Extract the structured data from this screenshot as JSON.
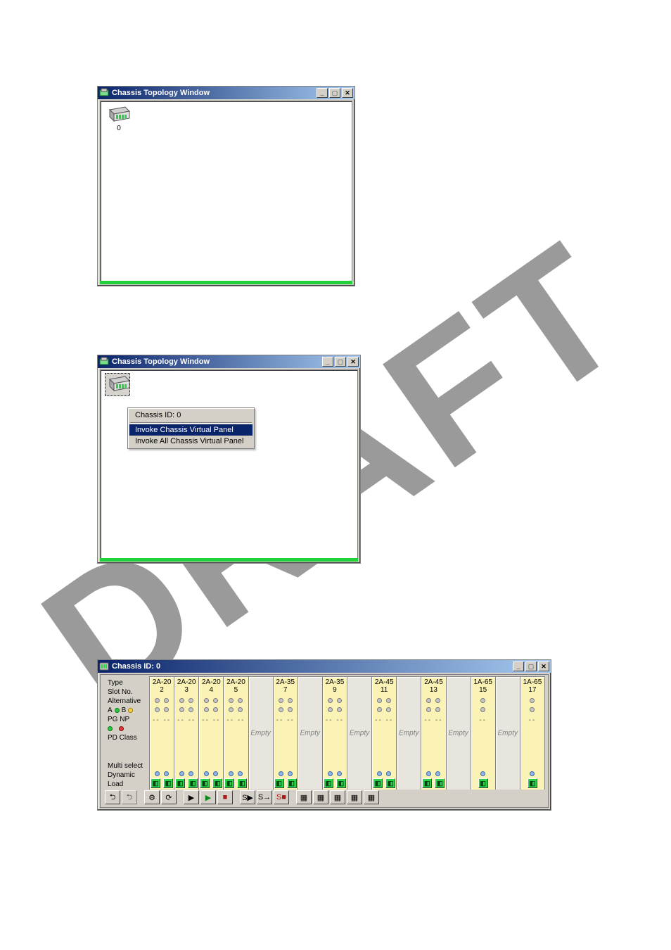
{
  "watermark_text": "DRAFT",
  "topology_window": {
    "title": "Chassis Topology Window",
    "chassis_label": "0"
  },
  "topology_window_menu": {
    "title": "Chassis Topology Window",
    "menu": {
      "header": "Chassis ID:   0",
      "items": [
        "Invoke Chassis Virtual Panel",
        "Invoke All Chassis Virtual Panel"
      ],
      "selected_index": 0
    }
  },
  "chassis_panel": {
    "title": "Chassis ID: 0",
    "row_labels": {
      "type": "Type",
      "slot_no": "Slot No.",
      "alternative": "Alternative",
      "ab": "A ● B ●",
      "pg_np": "PG NP",
      "pd_class": "PD Class",
      "multiselect": "Multi select",
      "dynamic_load": "Dynamic Load"
    },
    "slots": [
      {
        "type": "2A-20",
        "num": "2",
        "filled": true,
        "pairs": 2,
        "pd": "-- --"
      },
      {
        "type": "2A-20",
        "num": "3",
        "filled": true,
        "pairs": 2,
        "pd": "-- --"
      },
      {
        "type": "2A-20",
        "num": "4",
        "filled": true,
        "pairs": 2,
        "pd": "-- --"
      },
      {
        "type": "2A-20",
        "num": "5",
        "filled": true,
        "pairs": 2,
        "pd": "-- --"
      },
      {
        "empty_label": "Empty",
        "filled": false
      },
      {
        "type": "2A-35",
        "num": "7",
        "filled": true,
        "pairs": 2,
        "pd": "-- --"
      },
      {
        "empty_label": "Empty",
        "filled": false
      },
      {
        "type": "2A-35",
        "num": "9",
        "filled": true,
        "pairs": 2,
        "pd": "-- --"
      },
      {
        "empty_label": "Empty",
        "filled": false
      },
      {
        "type": "2A-45",
        "num": "11",
        "filled": true,
        "pairs": 2,
        "pd": "-- --"
      },
      {
        "empty_label": "Empty",
        "filled": false
      },
      {
        "type": "2A-45",
        "num": "13",
        "filled": true,
        "pairs": 2,
        "pd": "-- --"
      },
      {
        "empty_label": "Empty",
        "filled": false
      },
      {
        "type": "1A-65",
        "num": "15",
        "filled": true,
        "pairs": 1,
        "pd": "--"
      },
      {
        "empty_label": "Empty",
        "filled": false
      },
      {
        "type": "1A-65",
        "num": "17",
        "filled": true,
        "pairs": 1,
        "pd": "--"
      }
    ],
    "toolbar_icons": [
      "nav-back-icon",
      "nav-back2-icon",
      "",
      "scan-icon",
      "refresh-icon",
      "",
      "play-icon",
      "play-green-icon",
      "stop-icon",
      "",
      "sd-icon",
      "sd-arrow-icon",
      "sd-red-icon",
      "",
      "chip1-icon",
      "chip2-icon",
      "chip3-icon",
      "chip4-icon",
      "chip5-icon"
    ]
  }
}
